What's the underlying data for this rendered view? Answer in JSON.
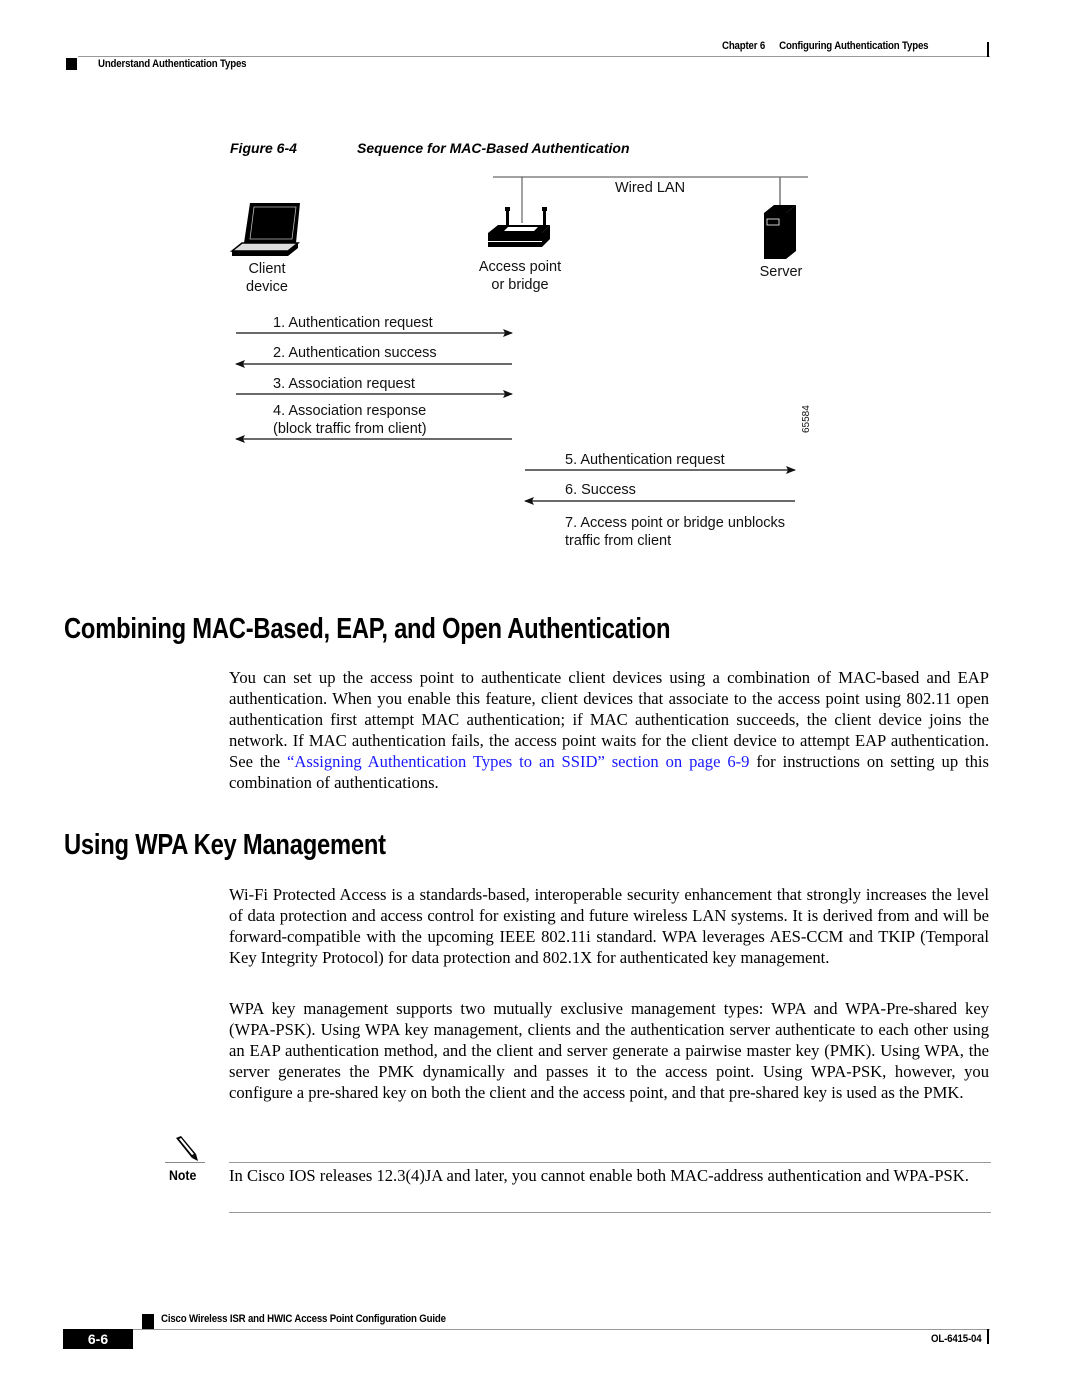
{
  "header": {
    "chapter": "Chapter 6",
    "chapter_title": "Configuring Authentication Types",
    "section": "Understand Authentication Types"
  },
  "figure": {
    "number": "Figure 6-4",
    "title": "Sequence for MAC-Based Authentication",
    "network_label": "Wired LAN",
    "nodes": {
      "client": [
        "Client",
        "device"
      ],
      "access_point": [
        "Access point",
        "or bridge"
      ],
      "server": [
        "Server"
      ]
    },
    "steps": [
      {
        "label": [
          "1. Authentication request"
        ],
        "from": "client",
        "to": "access_point"
      },
      {
        "label": [
          "2. Authentication success"
        ],
        "from": "access_point",
        "to": "client"
      },
      {
        "label": [
          "3. Association request"
        ],
        "from": "client",
        "to": "access_point"
      },
      {
        "label": [
          "4. Association response",
          "(block traffic from client)"
        ],
        "from": "access_point",
        "to": "client"
      },
      {
        "label": [
          "5. Authentication request"
        ],
        "from": "access_point",
        "to": "server"
      },
      {
        "label": [
          "6. Success"
        ],
        "from": "server",
        "to": "access_point"
      },
      {
        "label": [
          "7. Access point or bridge unblocks",
          "traffic from client"
        ],
        "from": null,
        "to": null
      }
    ],
    "figure_id": "65584"
  },
  "sections": [
    {
      "heading": "Combining MAC-Based, EAP, and Open Authentication",
      "paragraphs": [
        {
          "before_link": "You can set up the access point to authenticate client devices using a combination of MAC-based and EAP authentication. When you enable this feature, client devices that associate to the access point using 802.11 open authentication first attempt MAC authentication; if MAC authentication succeeds, the client device joins the network. If MAC authentication fails, the access point waits for the client device to attempt EAP authentication. See the ",
          "link": "“Assigning Authentication Types to an SSID” section on page 6-9",
          "after_link": " for instructions on setting up this combination of authentications."
        }
      ]
    },
    {
      "heading": "Using WPA Key Management",
      "paragraphs": [
        "Wi-Fi Protected Access is a standards-based, interoperable security enhancement that strongly increases the level of data protection and access control for existing and future wireless LAN systems. It is derived from and will be forward-compatible with the upcoming IEEE 802.11i standard. WPA leverages AES-CCM and TKIP (Temporal Key Integrity Protocol) for data protection and 802.1X for authenticated key management.",
        "WPA key management supports two mutually exclusive management types: WPA and WPA-Pre-shared key (WPA-PSK). Using WPA key management, clients and the authentication server authenticate to each other using an EAP authentication method, and the client and server generate a pairwise master key (PMK). Using WPA, the server generates the PMK dynamically and passes it to the access point. Using WPA-PSK, however, you configure a pre-shared key on both the client and the access point, and that pre-shared key is used as the PMK."
      ]
    }
  ],
  "note": {
    "icon": "pencil-note-icon",
    "label": "Note",
    "text": "In Cisco IOS releases 12.3(4)JA and later, you cannot enable both MAC-address authentication and WPA-PSK."
  },
  "footer": {
    "page_number": "6-6",
    "guide_title": "Cisco Wireless ISR and HWIC Access Point Configuration Guide",
    "doc_number": "OL-6415-04"
  },
  "colors": {
    "link": "#1a1aff",
    "rule": "#999999"
  }
}
